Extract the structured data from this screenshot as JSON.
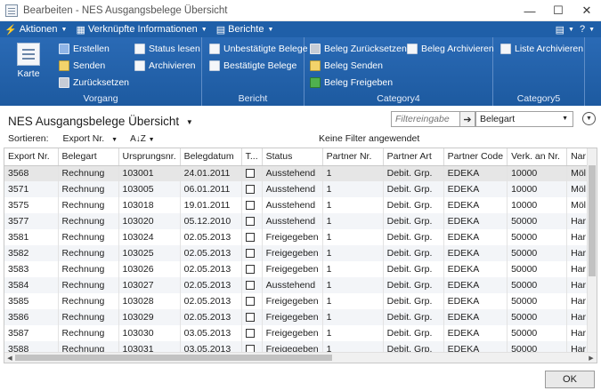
{
  "window": {
    "title": "Bearbeiten - NES Ausgangsbelege Übersicht",
    "minimize_glyph": "—",
    "maximize_glyph": "☐",
    "close_glyph": "✕"
  },
  "cmdbar": {
    "actions_label": "Aktionen",
    "linked_label": "Verknüpfte Informationen",
    "reports_label": "Berichte",
    "actions_glyph": "⚡",
    "linked_glyph": "▦",
    "reports_glyph": "▤",
    "view_glyph": "▤",
    "help_glyph": "?"
  },
  "ribbon": {
    "groups": {
      "vorgang": {
        "label": "Vorgang",
        "karte": "Karte",
        "erstellen": "Erstellen",
        "senden": "Senden",
        "zuruecksetzen": "Zurücksetzen",
        "status_lesen": "Status lesen",
        "archivieren": "Archivieren"
      },
      "bericht": {
        "label": "Bericht",
        "unbestaetigte": "Unbestätigte Belege",
        "bestaetigte": "Bestätigte Belege"
      },
      "category4": {
        "label": "Category4",
        "beleg_zuruecksetzen": "Beleg Zurücksetzen",
        "beleg_senden": "Beleg Senden",
        "beleg_freigeben": "Beleg Freigeben",
        "beleg_archivieren": "Beleg Archivieren"
      },
      "category5": {
        "label": "Category5",
        "liste_archivieren": "Liste Archivieren"
      }
    }
  },
  "page": {
    "title": "NES Ausgangsbelege Übersicht",
    "filter_placeholder": "Filtereingabe",
    "filter_field": "Belegart",
    "sort_label": "Sortieren:",
    "sort_value": "Export Nr.",
    "sort_dir_glyph": "A↓Z",
    "no_filter": "Keine Filter angewendet"
  },
  "grid": {
    "columns": [
      "Export Nr.",
      "Belegart",
      "Ursprungsnr.",
      "Belegdatum",
      "T...",
      "Status",
      "Partner Nr.",
      "Partner Art",
      "Partner Code",
      "Verk. an Nr.",
      "Nar"
    ],
    "rows": [
      [
        "3568",
        "Rechnung",
        "103001",
        "24.01.2011",
        "",
        "Ausstehend",
        "1",
        "Debit. Grp.",
        "EDEKA",
        "10000",
        "Möl"
      ],
      [
        "3571",
        "Rechnung",
        "103005",
        "06.01.2011",
        "",
        "Ausstehend",
        "1",
        "Debit. Grp.",
        "EDEKA",
        "10000",
        "Möl"
      ],
      [
        "3575",
        "Rechnung",
        "103018",
        "19.01.2011",
        "",
        "Ausstehend",
        "1",
        "Debit. Grp.",
        "EDEKA",
        "10000",
        "Möl"
      ],
      [
        "3577",
        "Rechnung",
        "103020",
        "05.12.2010",
        "",
        "Ausstehend",
        "1",
        "Debit. Grp.",
        "EDEKA",
        "50000",
        "Har"
      ],
      [
        "3581",
        "Rechnung",
        "103024",
        "02.05.2013",
        "",
        "Freigegeben",
        "1",
        "Debit. Grp.",
        "EDEKA",
        "50000",
        "Har"
      ],
      [
        "3582",
        "Rechnung",
        "103025",
        "02.05.2013",
        "",
        "Freigegeben",
        "1",
        "Debit. Grp.",
        "EDEKA",
        "50000",
        "Har"
      ],
      [
        "3583",
        "Rechnung",
        "103026",
        "02.05.2013",
        "",
        "Freigegeben",
        "1",
        "Debit. Grp.",
        "EDEKA",
        "50000",
        "Har"
      ],
      [
        "3584",
        "Rechnung",
        "103027",
        "02.05.2013",
        "",
        "Ausstehend",
        "1",
        "Debit. Grp.",
        "EDEKA",
        "50000",
        "Har"
      ],
      [
        "3585",
        "Rechnung",
        "103028",
        "02.05.2013",
        "",
        "Freigegeben",
        "1",
        "Debit. Grp.",
        "EDEKA",
        "50000",
        "Har"
      ],
      [
        "3586",
        "Rechnung",
        "103029",
        "02.05.2013",
        "",
        "Freigegeben",
        "1",
        "Debit. Grp.",
        "EDEKA",
        "50000",
        "Har"
      ],
      [
        "3587",
        "Rechnung",
        "103030",
        "03.05.2013",
        "",
        "Freigegeben",
        "1",
        "Debit. Grp.",
        "EDEKA",
        "50000",
        "Har"
      ],
      [
        "3588",
        "Rechnung",
        "103031",
        "03.05.2013",
        "",
        "Freigegeben",
        "1",
        "Debit. Grp.",
        "EDEKA",
        "50000",
        "Har"
      ]
    ]
  },
  "footer": {
    "ok_label": "OK"
  },
  "colors": {
    "ribbon": "#1f5fa8",
    "selection": "#e6e6e6",
    "alt_row": "#f3f5f8"
  }
}
